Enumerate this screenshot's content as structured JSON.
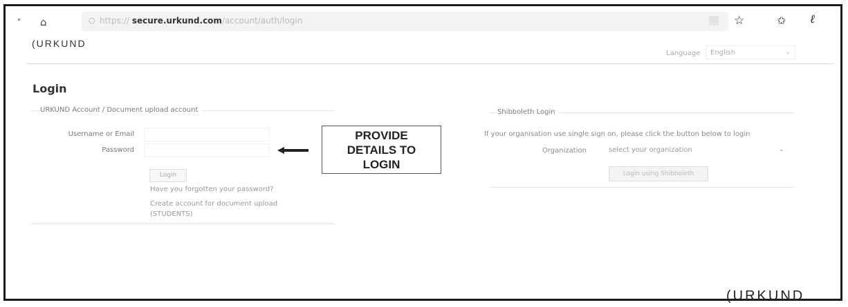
{
  "browser": {
    "url_protocol": "https://",
    "url_host": "secure.urkund.com",
    "url_path": "/account/auth/login"
  },
  "header": {
    "logo": "(URKUND",
    "language_label": "Language",
    "language_value": "English"
  },
  "page": {
    "title": "Login"
  },
  "left_panel": {
    "legend": "URKUND Account / Document upload account",
    "username_label": "Username or Email",
    "password_label": "Password",
    "login_button": "Login",
    "forgot_link": "Have you forgotten your password?",
    "create_link": "Create account for document upload",
    "create_link_note": "(STUDENTS)"
  },
  "callout": {
    "line1": "PROVIDE",
    "line2": "DETAILS TO",
    "line3": "LOGIN"
  },
  "right_panel": {
    "legend": "Shibboleth Login",
    "note": "If your organisation use single sign on, please click the button below to login",
    "organization_label": "Organization",
    "organization_select": "select your organization",
    "sso_button": "Login using Shibboleth"
  },
  "footer": {
    "logo": "(URKUND"
  },
  "icons": {
    "home": "home-icon",
    "lock": "lock-icon",
    "star": "star-icon",
    "favorites": "favorites-icon",
    "profile": "profile-icon",
    "arrow": "arrow-left-icon"
  }
}
